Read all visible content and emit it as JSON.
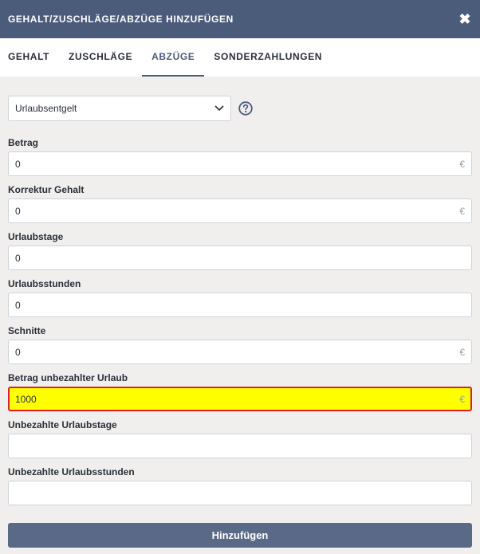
{
  "header": {
    "title": "GEHALT/ZUSCHLÄGE/ABZÜGE HINZUFÜGEN",
    "close_symbol": "✖"
  },
  "tabs": [
    {
      "label": "GEHALT",
      "active": false
    },
    {
      "label": "ZUSCHLÄGE",
      "active": false
    },
    {
      "label": "ABZÜGE",
      "active": true
    },
    {
      "label": "SONDERZAHLUNGEN",
      "active": false
    }
  ],
  "select": {
    "value": "Urlaubsentgelt"
  },
  "fields": [
    {
      "label": "Betrag",
      "value": "0",
      "suffix": "€"
    },
    {
      "label": "Korrektur Gehalt",
      "value": "0",
      "suffix": "€"
    },
    {
      "label": "Urlaubstage",
      "value": "0",
      "suffix": ""
    },
    {
      "label": "Urlaubsstunden",
      "value": "0",
      "suffix": ""
    },
    {
      "label": "Schnitte",
      "value": "0",
      "suffix": "€"
    },
    {
      "label": "Betrag unbezahlter Urlaub",
      "value": "1000",
      "suffix": "€",
      "highlighted": true
    },
    {
      "label": "Unbezahlte Urlaubstage",
      "value": "",
      "suffix": ""
    },
    {
      "label": "Unbezahlte Urlaubsstunden",
      "value": "",
      "suffix": ""
    }
  ],
  "submit_label": "Hinzufügen",
  "colors": {
    "header": "#4b5b7a",
    "highlight": "#ffff00",
    "highlight_border": "#d8222b",
    "button": "#5a6986"
  }
}
